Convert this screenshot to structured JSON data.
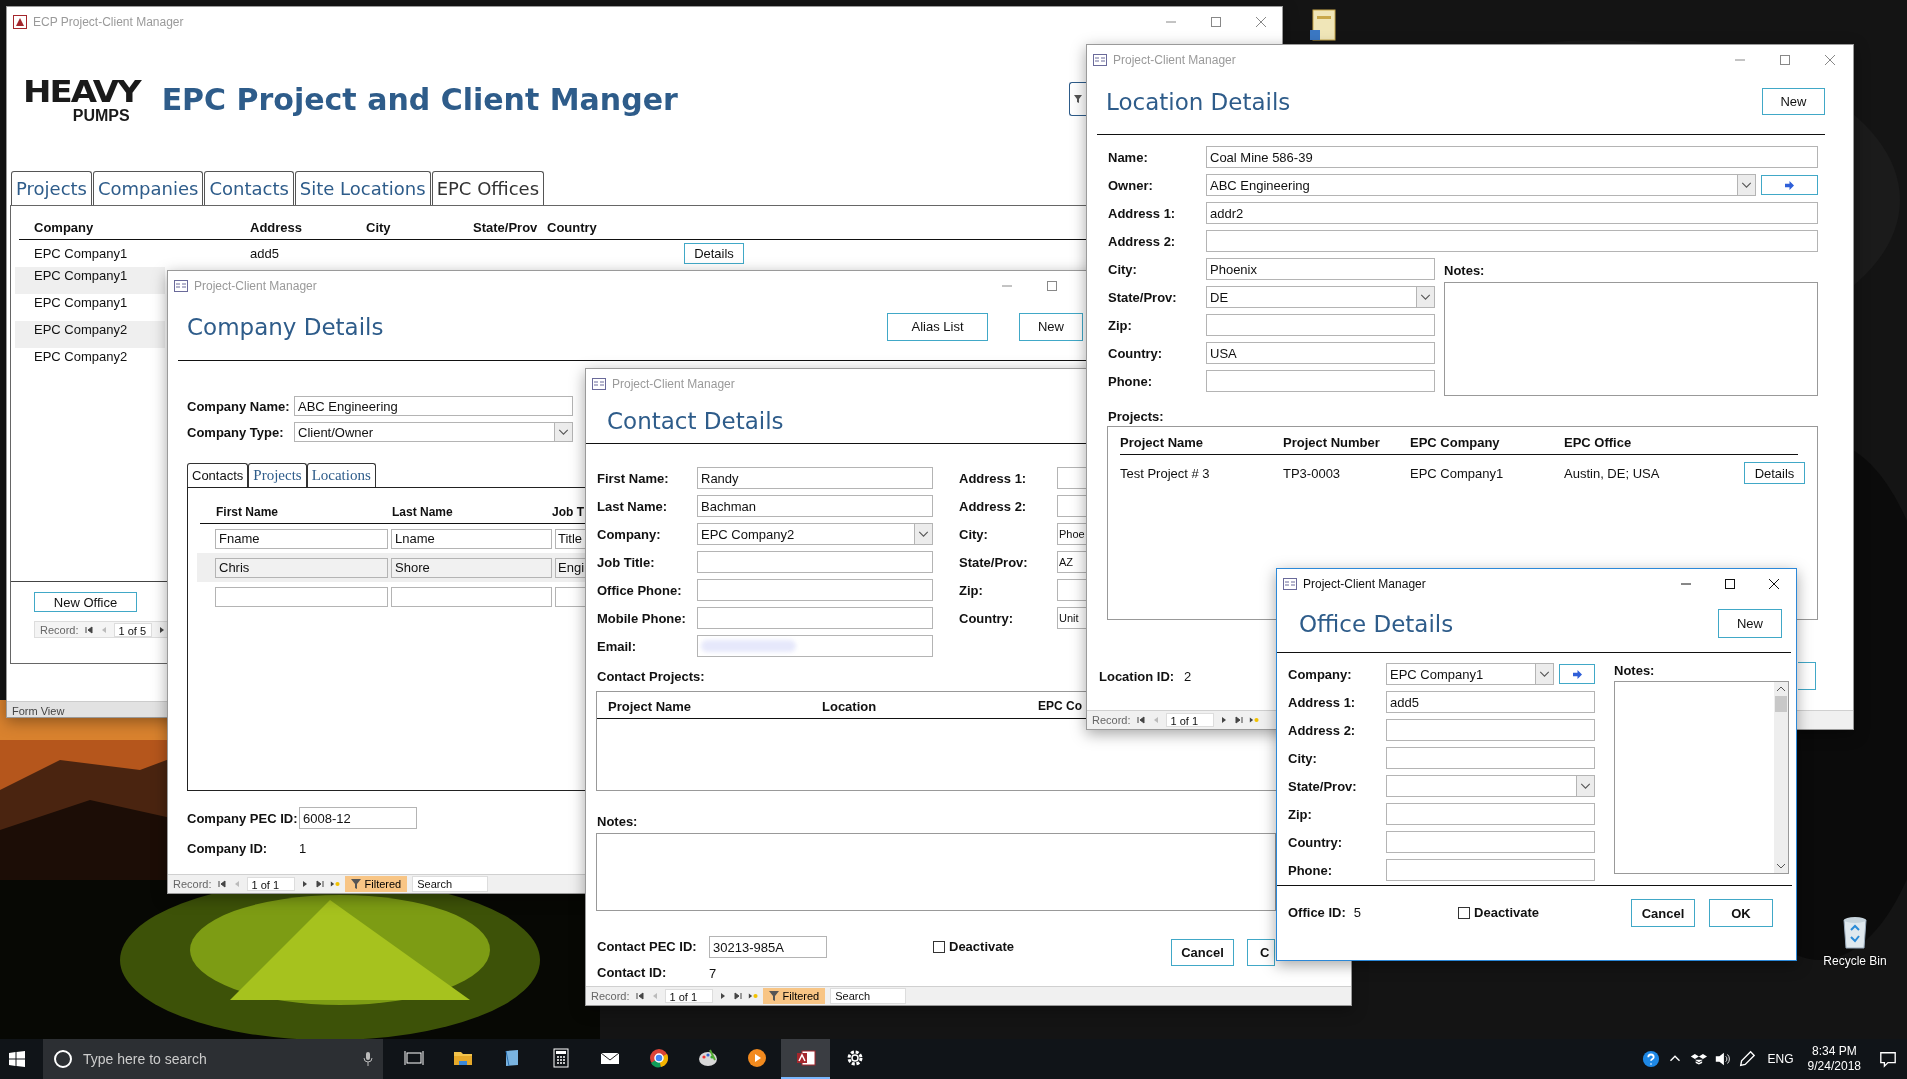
{
  "desktop": {
    "recycle_bin": "Recycle Bin"
  },
  "main_window": {
    "title": "ECP Project-Client Manager",
    "active": false,
    "logo": {
      "wordmark": "HEAVY",
      "subline": "PUMPS"
    },
    "heading": "EPC Project and Client Manger",
    "tabs": [
      {
        "label": "Projects",
        "selected": false
      },
      {
        "label": "Companies",
        "selected": false
      },
      {
        "label": "Contacts",
        "selected": false
      },
      {
        "label": "Site Locations",
        "selected": false
      },
      {
        "label": "EPC Offices",
        "selected": true
      }
    ],
    "list": {
      "columns": [
        "Company",
        "Address",
        "City",
        "State/Prov",
        "Country"
      ],
      "rows": [
        {
          "company": "EPC Company1",
          "address": "add5",
          "button": "Details"
        },
        {
          "company": "EPC Company1"
        },
        {
          "company": "EPC Company1"
        },
        {
          "company": "EPC Company2"
        },
        {
          "company": "EPC Company2"
        }
      ]
    },
    "new_button": "New Office",
    "record_nav": {
      "label": "Record:",
      "position": "1 of 5"
    },
    "status_bar": "Form View"
  },
  "company_window": {
    "title": "Project-Client Manager",
    "active": false,
    "heading": "Company Details",
    "buttons": [
      "Alias List",
      "New"
    ],
    "fields": [
      {
        "label": "Company Name:",
        "value": "ABC Engineering",
        "kind": "text"
      },
      {
        "label": "Company Type:",
        "value": "Client/Owner",
        "kind": "dropdown"
      }
    ],
    "subtabs": [
      {
        "label": "Contacts",
        "selected": true
      },
      {
        "label": "Projects",
        "selected": false
      },
      {
        "label": "Locations",
        "selected": false
      }
    ],
    "contacts": {
      "columns": [
        "First Name",
        "Last Name",
        "Job T"
      ],
      "rows": [
        [
          "Fname",
          "Lname",
          "Title"
        ],
        [
          "Chris",
          "Shore",
          "Engi"
        ]
      ]
    },
    "pec_id": {
      "label": "Company PEC ID:",
      "value": "6008-12"
    },
    "id": {
      "label": "Company ID:",
      "value": "1"
    },
    "record_nav": {
      "label": "Record:",
      "position": "1 of 1",
      "filter": "Filtered",
      "search": "Search"
    }
  },
  "contact_window": {
    "title": "Project-Client Manager",
    "active": false,
    "heading": "Contact Details",
    "fields_left": [
      {
        "label": "First Name:",
        "value": "Randy",
        "kind": "text"
      },
      {
        "label": "Last Name:",
        "value": "Bachman",
        "kind": "text"
      },
      {
        "label": "Company:",
        "value": "EPC Company2",
        "kind": "dropdown"
      },
      {
        "label": "Job Title:",
        "kind": "text"
      },
      {
        "label": "Office Phone:",
        "kind": "text"
      },
      {
        "label": "Mobile Phone:",
        "kind": "text"
      },
      {
        "label": "Email:",
        "kind": "blurred"
      }
    ],
    "fields_right": [
      {
        "label": "Address 1:"
      },
      {
        "label": "Address 2:"
      },
      {
        "label": "City:",
        "value": "Phoe"
      },
      {
        "label": "State/Prov:",
        "value": "AZ"
      },
      {
        "label": "Zip:"
      },
      {
        "label": "Country:",
        "value": "Unit"
      }
    ],
    "projects_label": "Contact Projects:",
    "projects_columns": [
      "Project Name",
      "Location",
      "EPC Co"
    ],
    "notes_label": "Notes:",
    "pec_id": {
      "label": "Contact PEC ID:",
      "value": "30213-985A"
    },
    "deactivate": {
      "label": "Deactivate",
      "checked": false
    },
    "id": {
      "label": "Contact ID:",
      "value": "7"
    },
    "buttons": [
      "Cancel",
      "C"
    ],
    "record_nav": {
      "label": "Record:",
      "position": "1 of 1",
      "filter": "Filtered",
      "search": "Search"
    }
  },
  "location_window": {
    "title": "Project-Client Manager",
    "active": false,
    "heading": "Location Details",
    "new_button": "New",
    "fields_top": [
      {
        "label": "Name:",
        "value": "Coal Mine 586-39",
        "kind": "text"
      },
      {
        "label": "Owner:",
        "value": "ABC Engineering",
        "kind": "dropdown_link"
      },
      {
        "label": "Address 1:",
        "value": "addr2",
        "kind": "text"
      },
      {
        "label": "Address 2:",
        "kind": "text"
      }
    ],
    "fields_side": [
      {
        "label": "City:",
        "value": "Phoenix",
        "kind": "text"
      },
      {
        "label": "State/Prov:",
        "value": "DE",
        "kind": "dropdown"
      },
      {
        "label": "Zip:",
        "kind": "text"
      },
      {
        "label": "Country:",
        "value": "USA",
        "kind": "text"
      },
      {
        "label": "Phone:",
        "kind": "text"
      }
    ],
    "notes_label": "Notes:",
    "projects_label": "Projects:",
    "projects": {
      "columns": [
        "Project Name",
        "Project Number",
        "EPC Company",
        "EPC Office"
      ],
      "rows": [
        {
          "cells": [
            "Test Project # 3",
            "TP3-0003",
            "EPC Company1",
            "Austin, DE; USA"
          ],
          "button": "Details"
        }
      ]
    },
    "id": {
      "label": "Location ID:",
      "value": "2"
    },
    "record_nav": {
      "label": "Record:",
      "position": "1 of 1"
    }
  },
  "office_window": {
    "title": "Project-Client Manager",
    "active": true,
    "heading": "Office Details",
    "new_button": "New",
    "fields": [
      {
        "label": "Company:",
        "value": "EPC Company1",
        "kind": "dropdown_link"
      },
      {
        "label": "Address 1:",
        "value": "add5",
        "kind": "text"
      },
      {
        "label": "Address 2:",
        "kind": "text"
      },
      {
        "label": "City:",
        "kind": "text"
      },
      {
        "label": "State/Prov:",
        "kind": "dropdown"
      },
      {
        "label": "Zip:",
        "kind": "text"
      },
      {
        "label": "Country:",
        "kind": "text"
      },
      {
        "label": "Phone:",
        "kind": "text"
      }
    ],
    "notes_label": "Notes:",
    "id": {
      "label": "Office ID:",
      "value": "5"
    },
    "deactivate": {
      "label": "Deactivate",
      "checked": false
    },
    "buttons": [
      "Cancel",
      "OK"
    ]
  },
  "taskbar": {
    "search": {
      "placeholder": "Type here to search"
    },
    "apps": [
      {
        "kind": "task_view",
        "active": false
      },
      {
        "kind": "folder",
        "active": false
      },
      {
        "kind": "book",
        "active": false
      },
      {
        "kind": "calculator",
        "active": false
      },
      {
        "kind": "mail",
        "active": false
      },
      {
        "kind": "browser",
        "active": false
      },
      {
        "kind": "palette",
        "active": false
      },
      {
        "kind": "play",
        "active": false
      },
      {
        "kind": "database",
        "active": true
      },
      {
        "kind": "gear",
        "active": false
      }
    ],
    "language": "ENG",
    "time": "8:34 PM",
    "date": "9/24/2018"
  }
}
